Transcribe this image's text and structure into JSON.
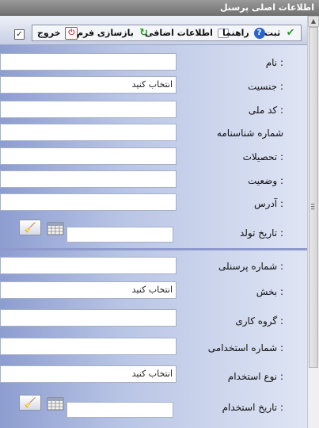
{
  "window": {
    "title": "اطلاعات اصلی پرسنل"
  },
  "toolbar": {
    "save_label": "ثبت",
    "help_label": "راهنما",
    "extra_label": "اطلاعات اضافی",
    "reset_label": "بازسازی فرم",
    "exit_label": "خروج",
    "checkbox_mark": "✓"
  },
  "fields": {
    "first_name": {
      "label": "نام :",
      "value": ""
    },
    "gender": {
      "label": "جنسیت :",
      "value": "انتخاب کنید"
    },
    "national_code": {
      "label": "کد ملی :",
      "value": ""
    },
    "id_number": {
      "label": "شماره شناسنامه",
      "value": ""
    },
    "education": {
      "label": "تحصیلات :",
      "value": ""
    },
    "status": {
      "label": "وضعیت :",
      "value": ""
    },
    "address": {
      "label": "آدرس :",
      "value": ""
    },
    "birth_date": {
      "label": "تاریخ تولد :",
      "value": ""
    },
    "personnel_no": {
      "label": "شماره پرسنلی :",
      "value": ""
    },
    "section": {
      "label": "بخش :",
      "value": "انتخاب کنید"
    },
    "work_group": {
      "label": "گروه کاری :",
      "value": ""
    },
    "employment_no": {
      "label": "شماره استخدامی :",
      "value": ""
    },
    "employment_type": {
      "label": "نوع استخدام :",
      "value": "انتخاب کنید"
    },
    "employment_date": {
      "label": "تاریخ استخدام :",
      "value": ""
    }
  },
  "colors": {
    "save": "#2e9c2e",
    "help": "#2a63c9",
    "reset": "#2e9c2e",
    "exit": "#d23a2a"
  },
  "icons": {
    "broom": "broom-icon",
    "calendar": "calendar-icon"
  }
}
